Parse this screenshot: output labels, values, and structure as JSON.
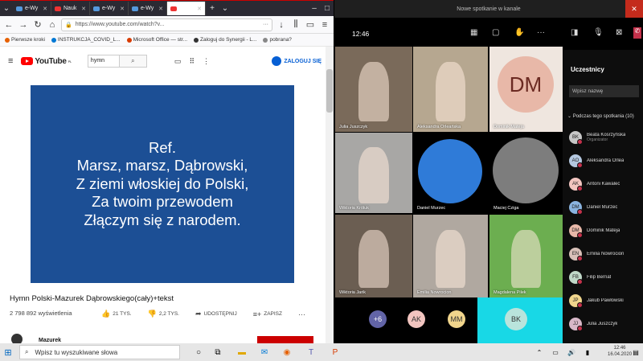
{
  "browser": {
    "tabs": [
      {
        "label": "e-Wy",
        "color": "#5599dd"
      },
      {
        "label": "Nauk",
        "color": "#e33"
      },
      {
        "label": "e-Wy",
        "color": "#5599dd"
      },
      {
        "label": "e-Wy",
        "color": "#5599dd"
      },
      {
        "label": "",
        "color": "#e33"
      }
    ],
    "url": "https://www.youtube.com/watch?v...",
    "bookmarks": [
      "Pierwsze kroki",
      "INSTRUKCJA_COVID_L...",
      "Microsoft Office — str...",
      "Zaloguj do Synergii - L...",
      "pobrana?"
    ]
  },
  "youtube": {
    "logo_text": "YouTube",
    "logo_sup": "PL",
    "search_value": "hymn",
    "signin_label": "ZALOGUJ SIĘ",
    "lyrics": [
      "Ref.",
      "Marsz, marsz, Dąbrowski,",
      "Z ziemi włoskiej do Polski,",
      "Za twoim przewodem",
      "Złączym się z narodem."
    ],
    "title": "Hymn Polski-Mazurek Dąbrowskiego(cały)+tekst",
    "views": "2 798 892 wyświetlenia",
    "likes": "21 TYS.",
    "dislikes": "2,2 TYS.",
    "share": "UDOSTĘPNIJ",
    "save": "ZAPISZ",
    "channel": "Mazurek"
  },
  "teams": {
    "window_title": "Nowe spotkanie w kanale",
    "time": "12:46",
    "tiles": [
      {
        "name": "Julia Juszczyk",
        "bg": "#7a6a5a"
      },
      {
        "name": "Aleksandra Orleańska",
        "bg": "#b6a790"
      },
      {
        "name": "Dominik Mateja",
        "bg": "#e8b8a8",
        "initials": "DM"
      },
      {
        "name": "Wiktoria Króluk",
        "bg": "#a8a7a5"
      },
      {
        "name": "Daniel Murzec",
        "bg": "#3060a8"
      },
      {
        "name": "Maciej Cziga",
        "bg": "#4a4a4a"
      },
      {
        "name": "Wiktoria Jarik",
        "bg": "#6b5e52"
      },
      {
        "name": "Emilia Nowrocion",
        "bg": "#b0a8a0"
      },
      {
        "name": "Magdalena Pilek",
        "bg": "#6cae50"
      }
    ],
    "bottom_avatars": [
      {
        "label": "+6",
        "bg": "#6264a7",
        "fg": "#fff"
      },
      {
        "label": "AK",
        "bg": "#f2c5c0",
        "fg": "#333"
      },
      {
        "label": "MM",
        "bg": "#f0d58c",
        "fg": "#333"
      },
      {
        "label": "BK",
        "bg": "#b9e4dc",
        "fg": "#333"
      }
    ],
    "participants": {
      "title": "Uczestnicy",
      "search_placeholder": "Wpisz nazwę",
      "section": "Podczas tego spotkania (10)",
      "people": [
        {
          "name": "Beata Kosrzyńska",
          "role": "Organizator",
          "initials": "BK",
          "bg": "#c7c7c7"
        },
        {
          "name": "Aleksandra Orlea",
          "role": "",
          "initials": "AO",
          "bg": "#b5c8e0"
        },
        {
          "name": "Antoni Kawalec",
          "role": "",
          "initials": "AK",
          "bg": "#f2c5c0"
        },
        {
          "name": "Daniel Murzec",
          "role": "",
          "initials": "DM",
          "bg": "#8ab4e0"
        },
        {
          "name": "Dominik Mateja",
          "role": "",
          "initials": "DM",
          "bg": "#e8b8a8"
        },
        {
          "name": "Emilia Nowrocion",
          "role": "",
          "initials": "EN",
          "bg": "#d8c0b8"
        },
        {
          "name": "Filip Bernat",
          "role": "",
          "initials": "FB",
          "bg": "#c0d8c8"
        },
        {
          "name": "Jakub Pawłowski",
          "role": "",
          "initials": "JP",
          "bg": "#f0d58c"
        },
        {
          "name": "Julia Juszczyk",
          "role": "",
          "initials": "JJ",
          "bg": "#d8b8c8"
        }
      ]
    }
  },
  "taskbar": {
    "search_placeholder": "Wpisz tu wyszukiwane słowa",
    "time": "12:46",
    "date": "16.04.2020"
  }
}
